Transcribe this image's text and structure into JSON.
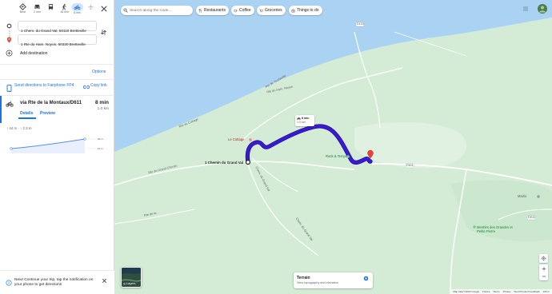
{
  "modes": [
    {
      "label": "Best",
      "icon": "diamond-turn-icon"
    },
    {
      "label": "2 min",
      "icon": "car-icon"
    },
    {
      "label": "",
      "icon": "bus-icon"
    },
    {
      "label": "16 min",
      "icon": "walk-icon"
    },
    {
      "label": "8 min",
      "icon": "bicycle-icon",
      "active": true
    },
    {
      "label": "",
      "icon": "flight-icon"
    }
  ],
  "origin": "1 Chem. du Grand Val, 50110 Bretteville",
  "destination": "1 Rte du Ham. Noyon, 50330 Bretteville",
  "add_destination": "Add destination",
  "options": "Options",
  "send_directions": "Send directions to Fairphone FP4",
  "copy_link": "Copy link",
  "route": {
    "via": "via Rte de la Montaux/D611",
    "time": "8 min",
    "distance": "1.0 km",
    "details": "Details",
    "preview": "Preview"
  },
  "elevation": {
    "summary": "↑ 44 m · ↓ 2.3 m",
    "ticks": [
      "30 m",
      "10 m"
    ]
  },
  "notice": "New! Continue your trip, tap the notification on your phone to get directions",
  "map": {
    "search_placeholder": "Search along the route...",
    "chips": [
      "Restaurants",
      "Coffee",
      "Groceries",
      "Things to do"
    ],
    "route_tip": {
      "time": "8 min",
      "distance": "1.0 km"
    },
    "start_label": "1 Chemin du Grand Val",
    "labels": {
      "cottage": "Le Cottage",
      "rock": "Rock & Temps",
      "mairie": "Mairie",
      "menhirs": "Menhirs des Grandes et Petite Pierre",
      "rte_tourlaville": "Rte de Tourlaville",
      "rte_ham_noyon": "Rte du Ham. Noyon",
      "rte_grand_chemin": "Rte du Grand Chemin",
      "chem_grand_val": "Chem. du Grand Val",
      "chem_grand_val2": "Chem. du Grand Val",
      "rte_cottage": "Rte du Cottage",
      "d611": "D611",
      "d611b": "D611",
      "d116": "D116",
      "rte_de_la": "Rte de la..."
    },
    "terrain": {
      "title": "Terrain",
      "subtitle": "View topography and elevation"
    },
    "layers": "Layers",
    "attribution": [
      "Map data ©2024 Google",
      "France",
      "Terms",
      "Privacy",
      "Send Product Feedback",
      "100 m"
    ]
  },
  "colors": {
    "accent": "#1a73e8",
    "route": "#3d1bcc",
    "land": "#d4ecd6",
    "water": "#aad2f2",
    "pin": "#ea4335"
  }
}
